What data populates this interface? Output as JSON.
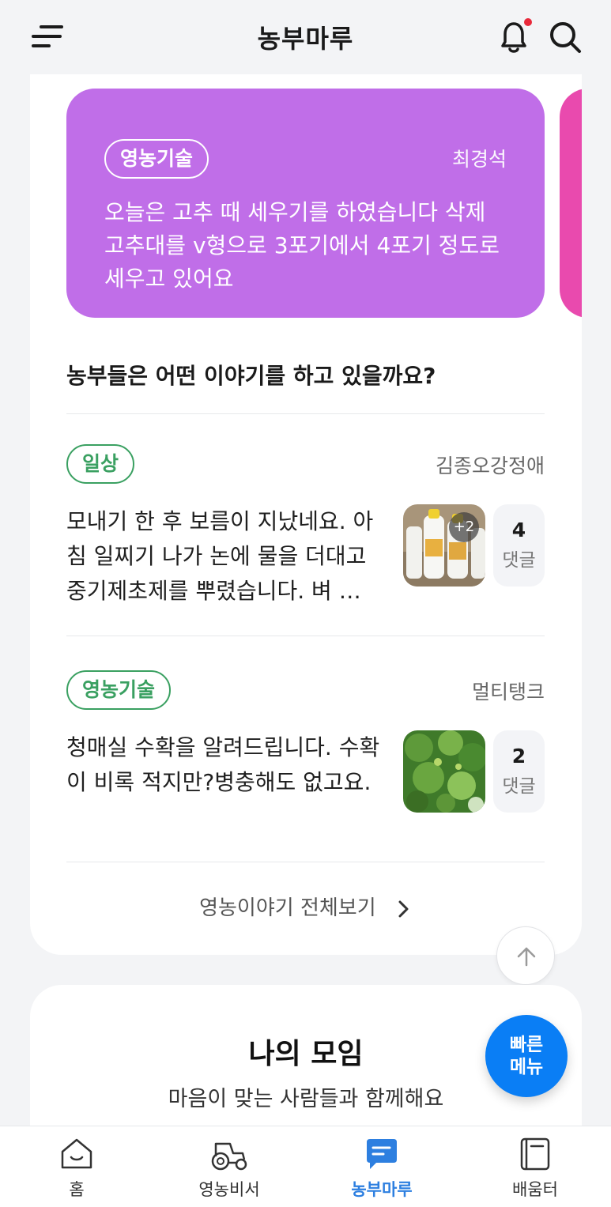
{
  "header": {
    "title": "농부마루",
    "has_notification": true
  },
  "featured": {
    "badge": "영농기술",
    "author": "최경석",
    "text": "오늘은 고추 때 세우기를 하였습니다 삭제 고추대를 v형으로 3포기에서 4포기 정도로 세우고 있어요",
    "color": "#c06ee8",
    "next_color": "#e94aae"
  },
  "section": {
    "title": "농부들은 어떤 이야기를 하고 있을까요?"
  },
  "posts": [
    {
      "tag": "일상",
      "author": "김종오강정애",
      "body": "모내기 한 후 보름이 지났네요. 아침 일찌기 나가 논에 물을 더대고 중기제초제를 뿌렸습니다. 벼 …",
      "thumb_more": "+2",
      "comment_count": "4",
      "comment_label": "댓글"
    },
    {
      "tag": "영농기술",
      "author": "멀티탱크",
      "body": "청매실 수확을 알려드립니다. 수확이 비록 적지만?병충해도 없고요.",
      "comment_count": "2",
      "comment_label": "댓글"
    }
  ],
  "view_all": "영농이야기 전체보기",
  "group": {
    "title": "나의 모임",
    "subtitle": "마음이 맞는 사람들과 함께해요"
  },
  "quick_menu": {
    "line1": "빠른",
    "line2": "메뉴"
  },
  "nav": [
    {
      "label": "홈",
      "icon": "home-icon",
      "active": false
    },
    {
      "label": "영농비서",
      "icon": "tractor-icon",
      "active": false
    },
    {
      "label": "농부마루",
      "icon": "chat-icon",
      "active": true
    },
    {
      "label": "배움터",
      "icon": "book-icon",
      "active": false
    }
  ],
  "colors": {
    "accent": "#2d7fe0",
    "tag_green": "#3aa061",
    "quick_menu": "#0a7ef5"
  }
}
